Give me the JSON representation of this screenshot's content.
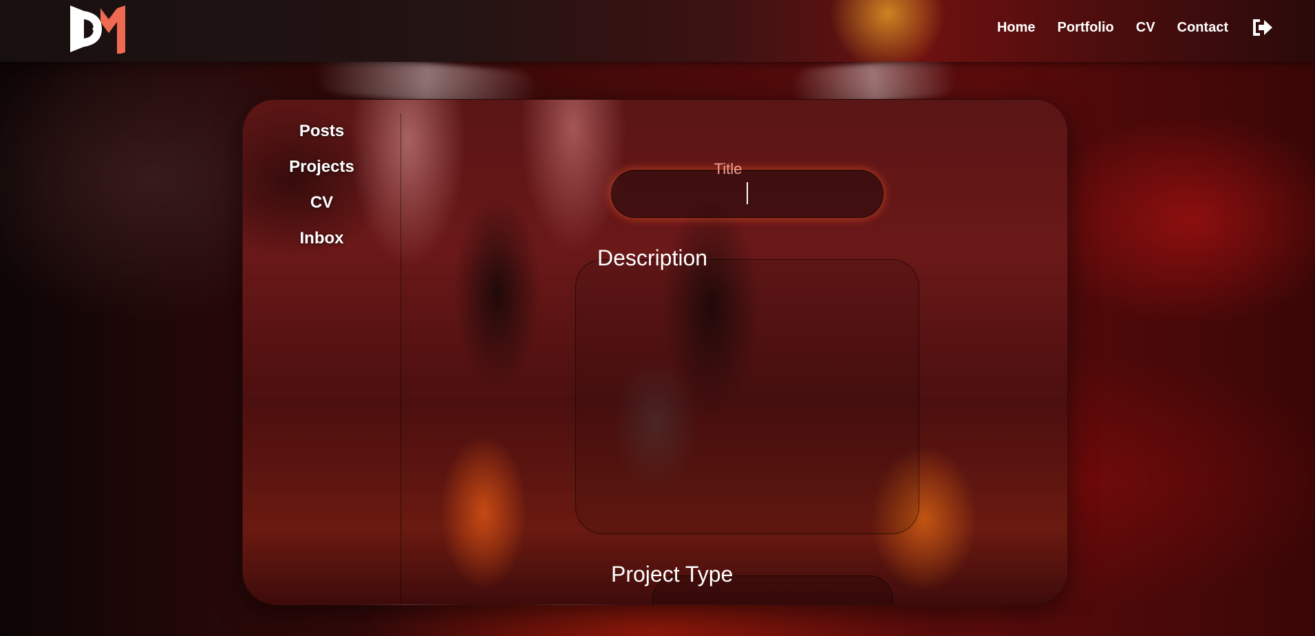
{
  "brand": {
    "logo_text": "DM",
    "colors": {
      "logo_white": "#ffffff",
      "logo_accent": "#ef6a52",
      "title_label": "#f0a090",
      "glow": "#ff5a28"
    }
  },
  "navbar": {
    "links": [
      {
        "label": "Home"
      },
      {
        "label": "Portfolio"
      },
      {
        "label": "CV"
      },
      {
        "label": "Contact"
      }
    ],
    "logout_icon": "sign-out-icon"
  },
  "sidebar": {
    "items": [
      {
        "label": "Posts"
      },
      {
        "label": "Projects"
      },
      {
        "label": "CV"
      },
      {
        "label": "Inbox"
      }
    ]
  },
  "form": {
    "title": {
      "label": "Title",
      "value": ""
    },
    "description": {
      "label": "Description",
      "value": ""
    },
    "project_type": {
      "label": "Project Type",
      "value": ""
    }
  }
}
